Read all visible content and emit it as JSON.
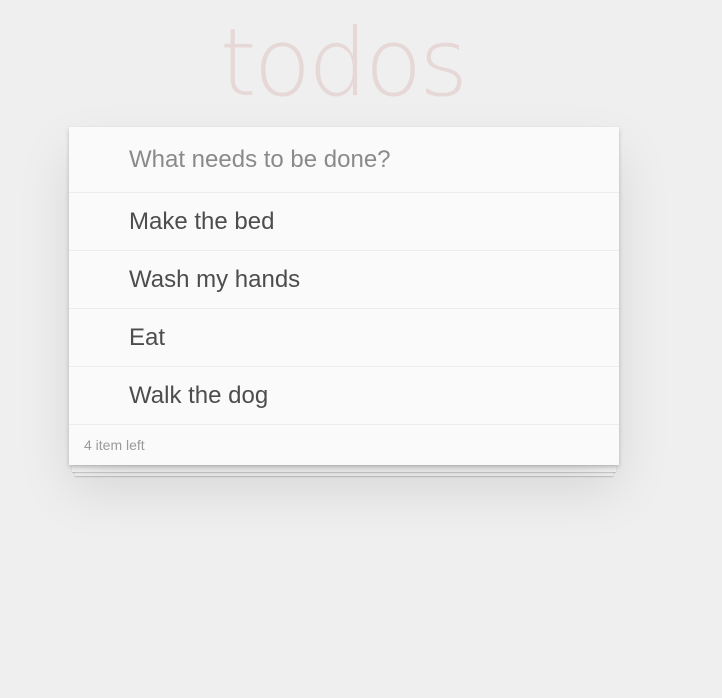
{
  "header": {
    "title": "todos"
  },
  "new_todo": {
    "placeholder": "What needs to be done?",
    "value": ""
  },
  "todos": [
    {
      "label": "Make the bed"
    },
    {
      "label": "Wash my hands"
    },
    {
      "label": "Eat"
    },
    {
      "label": "Walk the dog"
    }
  ],
  "footer": {
    "count_text": "4 item left"
  }
}
